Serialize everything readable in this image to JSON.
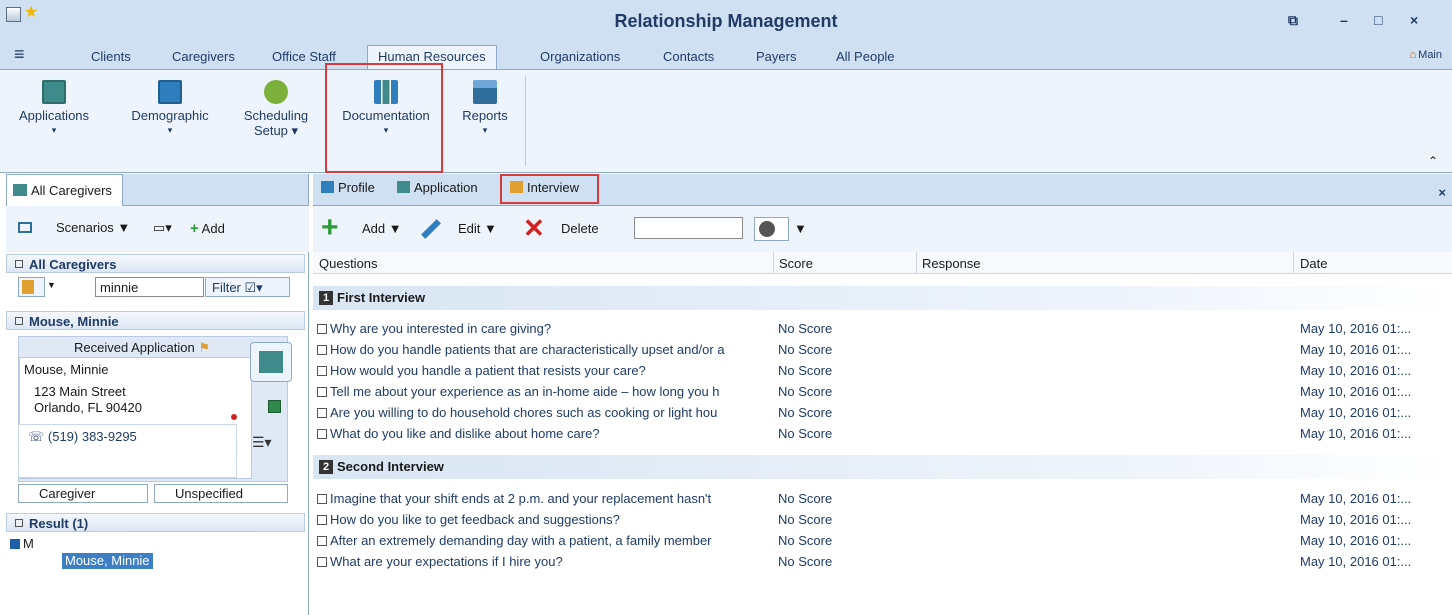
{
  "window": {
    "title": "Relationship Management",
    "controls": [
      "⧉",
      "–",
      "□",
      "×"
    ]
  },
  "menu": {
    "tabs": [
      "Clients",
      "Caregivers",
      "Office Staff",
      "Human Resources",
      "Organizations",
      "Contacts",
      "Payers",
      "All People"
    ],
    "main_link": "Main"
  },
  "ribbon": {
    "buttons": [
      {
        "label": "Applications",
        "icon": "application-icon"
      },
      {
        "label": "Demographic",
        "icon": "demographic-icon"
      },
      {
        "label": "Scheduling",
        "label2": "Setup",
        "icon": "gear-icon"
      },
      {
        "label": "Documentation",
        "icon": "books-icon"
      },
      {
        "label": "Reports",
        "icon": "printer-icon"
      }
    ]
  },
  "left": {
    "tab": "All Caregivers",
    "toolbar": {
      "scenarios": "Scenarios",
      "add": "Add"
    },
    "section1": "All Caregivers",
    "search_value": "minnie",
    "filter": "Filter",
    "section2": "Mouse, Minnie",
    "card": {
      "status": "Received Application",
      "name": "Mouse, Minnie",
      "street": "123 Main Street",
      "city": "Orlando, FL  90420",
      "phone": "(519) 383-9295"
    },
    "chips": [
      "Caregiver",
      "Unspecified"
    ],
    "result": "Result (1)",
    "tree": {
      "root": "M",
      "child": "Mouse, Minnie"
    }
  },
  "right": {
    "tabs": [
      "Profile",
      "Application",
      "Interview"
    ],
    "toolbar": {
      "add": "Add",
      "edit": "Edit",
      "delete": "Delete"
    },
    "columns": [
      "Questions",
      "Score",
      "Response",
      "Date"
    ],
    "groups": [
      {
        "num": "1",
        "title": "First Interview",
        "rows": [
          {
            "q": "Why are you interested in care giving?",
            "score": "No Score",
            "date": "May 10, 2016 01:..."
          },
          {
            "q": "How do you handle patients that are characteristically upset and/or a",
            "score": "No Score",
            "date": "May 10, 2016 01:..."
          },
          {
            "q": "How would you handle a patient that resists your care?",
            "score": "No Score",
            "date": "May 10, 2016 01:..."
          },
          {
            "q": "Tell me about your experience as an in-home aide – how long you h",
            "score": "No Score",
            "date": "May 10, 2016 01:..."
          },
          {
            "q": "Are you willing to do household chores such as cooking or light hou",
            "score": "No Score",
            "date": "May 10, 2016 01:..."
          },
          {
            "q": "What do you like and dislike about home care?",
            "score": "No Score",
            "date": "May 10, 2016 01:..."
          }
        ]
      },
      {
        "num": "2",
        "title": "Second Interview",
        "rows": [
          {
            "q": "Imagine that your shift ends at 2 p.m. and your replacement hasn't",
            "score": "No Score",
            "date": "May 10, 2016 01:..."
          },
          {
            "q": "How do you like to get feedback and suggestions?",
            "score": "No Score",
            "date": "May 10, 2016 01:..."
          },
          {
            "q": "After an extremely demanding day with a patient, a family member",
            "score": "No Score",
            "date": "May 10, 2016 01:..."
          },
          {
            "q": "What are your expectations if I hire you?",
            "score": "No Score",
            "date": "May 10, 2016 01:..."
          }
        ]
      }
    ]
  }
}
